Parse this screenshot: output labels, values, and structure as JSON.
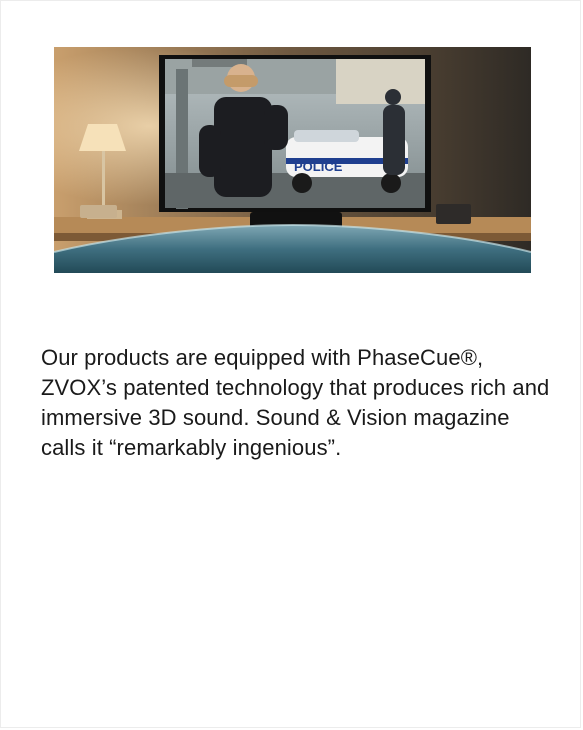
{
  "hero": {
    "alt": "TV showing police scene with soundbar",
    "tv_overlay_text": "POLICE"
  },
  "copy": {
    "paragraph": "Our products are equipped with PhaseCue®, ZVOX’s patented technology that produces rich and immersive 3D sound. Sound & Vision magazine calls it “remarkably ingenious”."
  },
  "colors": {
    "background": "#ffffff",
    "text": "#1a1a1a",
    "table_teal": "#2b5a6b"
  }
}
